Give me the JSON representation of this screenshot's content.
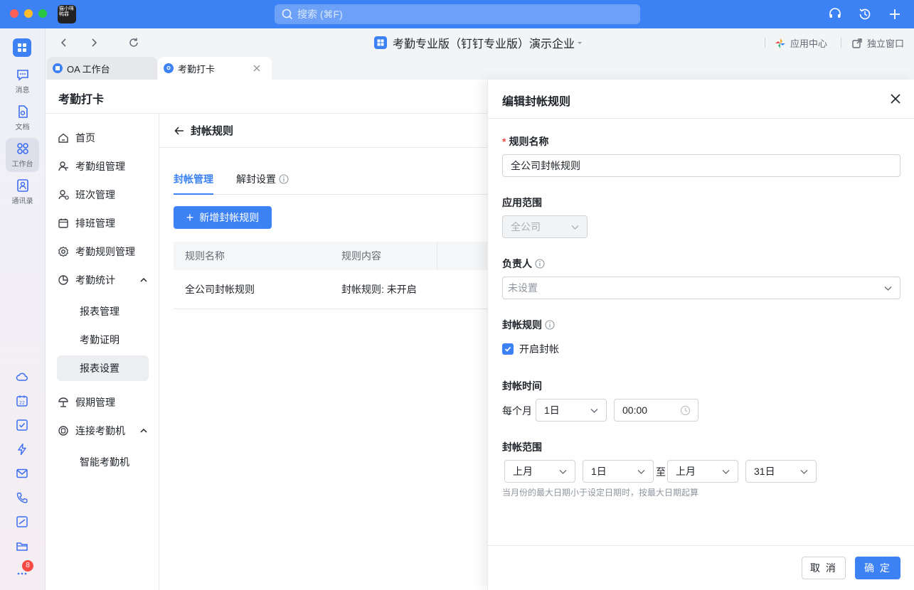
{
  "titlebar": {
    "search_placeholder": "搜索 (⌘F)",
    "avatar_text": "猫小咪 鸭罪"
  },
  "dock": {
    "items": [
      {
        "label": "消息",
        "icon": "message-icon"
      },
      {
        "label": "文档",
        "icon": "document-icon"
      },
      {
        "label": "工作台",
        "icon": "workbench-icon"
      },
      {
        "label": "通讯录",
        "icon": "contacts-icon"
      }
    ],
    "badge": "8"
  },
  "navbar": {
    "org_title": "考勤专业版（钉钉专业版）演示企业",
    "app_center": "应用中心",
    "standalone": "独立窗口"
  },
  "tabs": [
    {
      "label": "OA 工作台"
    },
    {
      "label": "考勤打卡"
    }
  ],
  "page": {
    "title": "考勤打卡",
    "content_title": "封帐规则"
  },
  "menu": {
    "items": [
      {
        "label": "首页"
      },
      {
        "label": "考勤组管理"
      },
      {
        "label": "班次管理"
      },
      {
        "label": "排班管理"
      },
      {
        "label": "考勤规则管理"
      },
      {
        "label": "考勤统计"
      },
      {
        "label": "报表管理"
      },
      {
        "label": "考勤证明"
      },
      {
        "label": "报表设置"
      },
      {
        "label": "假期管理"
      },
      {
        "label": "连接考勤机"
      },
      {
        "label": "智能考勤机"
      }
    ]
  },
  "subtabs": {
    "manage": "封帐管理",
    "unseal": "解封设置"
  },
  "add_button": "新增封帐规则",
  "table": {
    "headers": [
      "规则名称",
      "规则内容"
    ],
    "rows": [
      [
        "全公司封帐规则",
        "封帐规则: 未开启"
      ]
    ]
  },
  "drawer": {
    "title": "编辑封帐规则",
    "rule_name_label": "规则名称",
    "rule_name_value": "全公司封帐规则",
    "scope_label": "应用范围",
    "scope_value": "全公司",
    "owner_label": "负责人",
    "owner_placeholder": "未设置",
    "seal_rule_label": "封帐规则",
    "enable_seal": "开启封帐",
    "seal_time_label": "封帐时间",
    "every_month": "每个月",
    "day_value": "1日",
    "time_value": "00:00",
    "seal_range_label": "封帐范围",
    "range_start_month": "上月",
    "range_start_day": "1日",
    "range_to": "至",
    "range_end_month": "上月",
    "range_end_day": "31日",
    "hint": "当月份的最大日期小于设定日期时，按最大日期起算",
    "cancel": "取 消",
    "confirm": "确 定"
  }
}
